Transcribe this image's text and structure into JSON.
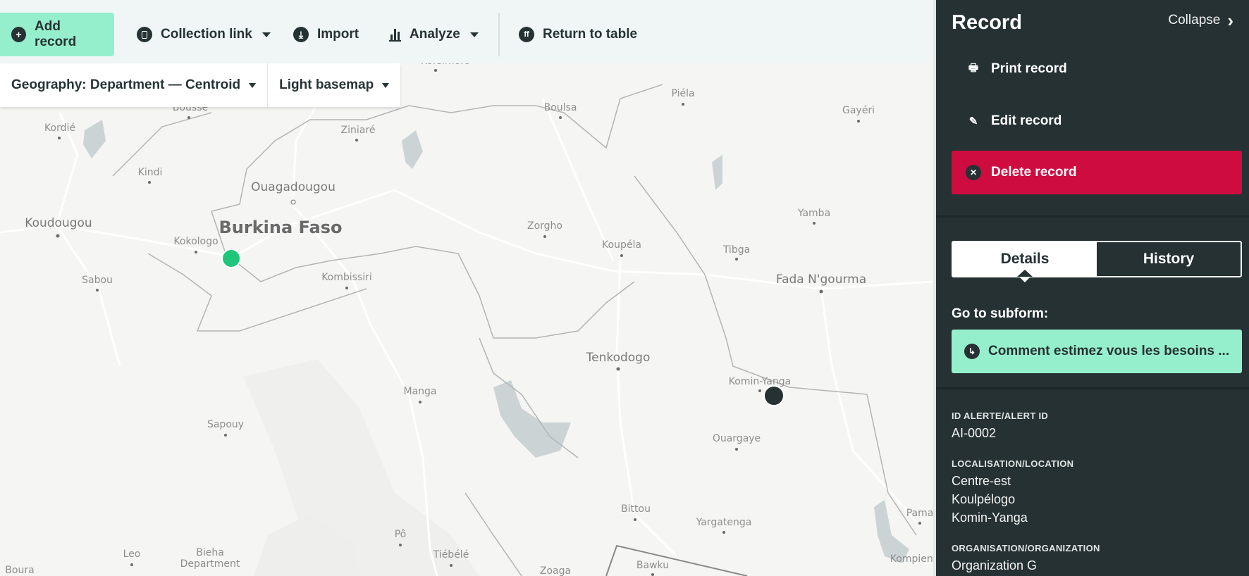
{
  "toolbar": {
    "add_record": "Add record",
    "collection_link": "Collection link",
    "import": "Import",
    "analyze": "Analyze",
    "return_to_table": "Return to table"
  },
  "map_controls": {
    "geography": "Geography: Department — Centroid",
    "basemap": "Light basemap"
  },
  "map": {
    "country_label": "Burkina Faso",
    "places": [
      {
        "name": "Korsimoro",
        "size": "small"
      },
      {
        "name": "Bousse",
        "size": "small"
      },
      {
        "name": "Kordié",
        "size": "small"
      },
      {
        "name": "Ziniaré",
        "size": "small"
      },
      {
        "name": "Boulsa",
        "size": "small"
      },
      {
        "name": "Piéla",
        "size": "small"
      },
      {
        "name": "Gayéri",
        "size": "small"
      },
      {
        "name": "Kindi",
        "size": "small"
      },
      {
        "name": "Ouagadougou",
        "size": "medium"
      },
      {
        "name": "Koudougou",
        "size": "medium"
      },
      {
        "name": "Kokologo",
        "size": "small"
      },
      {
        "name": "Yamba",
        "size": "small"
      },
      {
        "name": "Zorgho",
        "size": "small"
      },
      {
        "name": "Koupéla",
        "size": "small"
      },
      {
        "name": "Tibga",
        "size": "small"
      },
      {
        "name": "Sabou",
        "size": "small"
      },
      {
        "name": "Kombissiri",
        "size": "small"
      },
      {
        "name": "Fada N'gourma",
        "size": "medium"
      },
      {
        "name": "Tenkodogo",
        "size": "medium"
      },
      {
        "name": "Komin-Yanga",
        "size": "small"
      },
      {
        "name": "Manga",
        "size": "small"
      },
      {
        "name": "Sapouy",
        "size": "small"
      },
      {
        "name": "Ouargaye",
        "size": "small"
      },
      {
        "name": "Bittou",
        "size": "small"
      },
      {
        "name": "Yargatenga",
        "size": "small"
      },
      {
        "name": "Pama",
        "size": "small"
      },
      {
        "name": "Pô",
        "size": "small"
      },
      {
        "name": "Leo",
        "size": "small"
      },
      {
        "name": "Bieha Department",
        "size": "small"
      },
      {
        "name": "Tiébélé",
        "size": "small"
      },
      {
        "name": "Boura",
        "size": "small"
      },
      {
        "name": "Zoaga",
        "size": "small"
      },
      {
        "name": "Bawku",
        "size": "small"
      },
      {
        "name": "Kompienga",
        "size": "small"
      }
    ],
    "markers": [
      {
        "name": "record-marker-unselected",
        "color": "#1fc67a"
      },
      {
        "name": "record-marker-selected",
        "color": "#263133"
      }
    ]
  },
  "panel": {
    "title": "Record",
    "collapse": "Collapse",
    "actions": {
      "print": "Print record",
      "edit": "Edit record",
      "delete": "Delete record"
    },
    "tabs": [
      {
        "label": "Details",
        "active": true
      },
      {
        "label": "History",
        "active": false
      }
    ],
    "subform_label": "Go to subform:",
    "subform_button": "Comment estimez vous les besoins ...",
    "fields": [
      {
        "label": "ID ALERTE/ALERT ID",
        "values": [
          "AI-0002"
        ]
      },
      {
        "label": "LOCALISATION/LOCATION",
        "values": [
          "Centre-est",
          "Koulpélogo",
          "Komin-Yanga"
        ]
      },
      {
        "label": "ORGANISATION/ORGANIZATION",
        "values": [
          "Organization G"
        ]
      }
    ]
  },
  "colors": {
    "accent": "#96efcc",
    "panel_bg": "#263133",
    "danger": "#cf0c40",
    "marker_green": "#1fc67a"
  }
}
